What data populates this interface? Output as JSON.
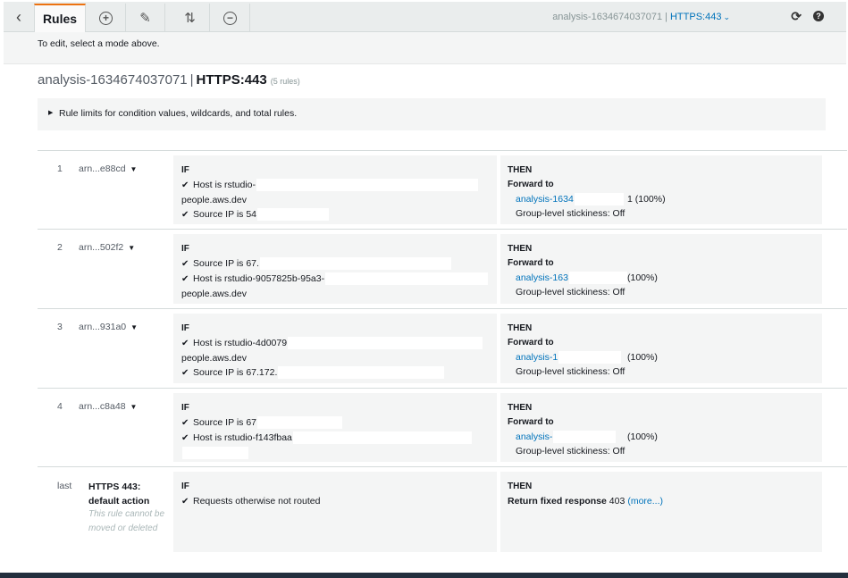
{
  "toolbar": {
    "rules_tab": "Rules",
    "lb_name": "analysis-1634674037071",
    "separator": "|",
    "listener": "HTTPS:443"
  },
  "hint": "To edit, select a mode above.",
  "heading": {
    "lb_name": "analysis-1634674037071",
    "separator": "|",
    "listener": "HTTPS:443",
    "count": "(5 rules)"
  },
  "limits_text": "Rule limits for condition values, wildcards, and total rules.",
  "labels": {
    "if": "IF",
    "then": "THEN",
    "forward": "Forward to",
    "stickiness": "Group-level stickiness: Off"
  },
  "rules": [
    {
      "num": "1",
      "arn": "arn...e88cd",
      "cond1": "Host is rstudio-",
      "cond1b": "people.aws.dev",
      "cond2": "Source IP is 54",
      "tg": "analysis-1634",
      "pct": "1 (100%)"
    },
    {
      "num": "2",
      "arn": "arn...502f2",
      "cond1": "Source IP is 67.",
      "cond2": "Host is rstudio-9057825b-95a3-",
      "cond2b": "people.aws.dev",
      "tg": "analysis-163",
      "pct": "(100%)"
    },
    {
      "num": "3",
      "arn": "arn...931a0",
      "cond1": "Host is rstudio-4d0079",
      "cond1b": "people.aws.dev",
      "cond2": "Source IP is 67.172.",
      "tg": "analysis-1",
      "pct": "(100%)"
    },
    {
      "num": "4",
      "arn": "arn...c8a48",
      "cond1": "Source IP is 67",
      "cond2": "Host is rstudio-f143fbaa",
      "tg": "analysis-",
      "pct": "(100%)"
    }
  ],
  "default_rule": {
    "num": "last",
    "name": "HTTPS 443: default action",
    "note": "This rule cannot be moved or deleted",
    "condition": "Requests otherwise not routed",
    "action": "Return fixed response",
    "code": "403",
    "more": "(more...)"
  },
  "icons": {
    "back": "chevron-left-icon",
    "add": "plus-circle-icon",
    "edit": "pencil-icon",
    "reorder": "reorder-icon",
    "delete": "minus-circle-icon",
    "refresh": "refresh-icon",
    "help": "help-icon"
  },
  "colors": {
    "accent_tab": "#ec7211",
    "link": "#0073bb",
    "panel_bg": "#f4f5f5",
    "toolbar_bg": "#eaeded"
  }
}
